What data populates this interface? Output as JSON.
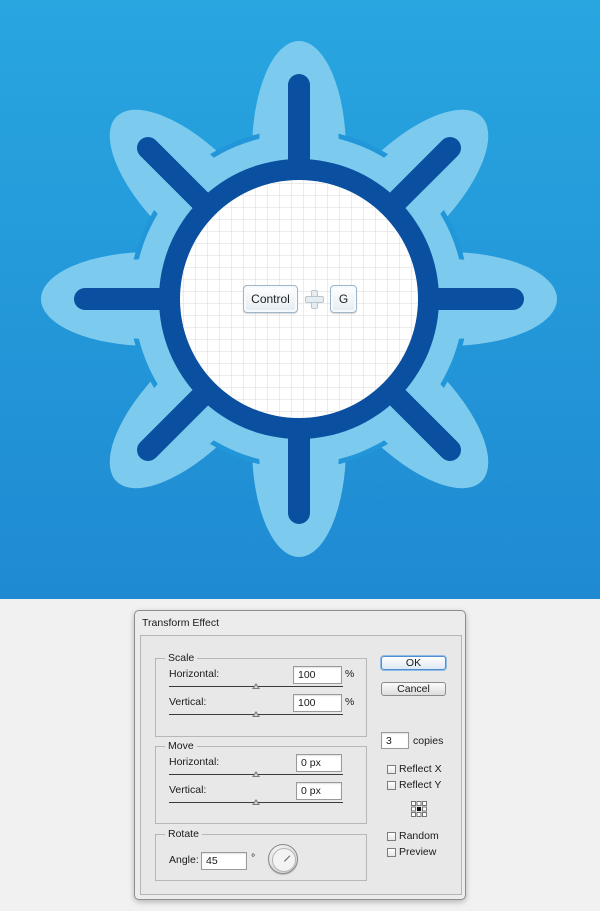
{
  "canvas": {
    "background_top": "#28a6e0",
    "background_bottom": "#1f8ad2",
    "petal_color": "#7ccbee",
    "ring_color": "#0a4fa0",
    "spoke_color": "#0a4fa0",
    "center_color": "#ffffff",
    "grid_color": "#d9d9d9",
    "shortcut": {
      "key1": "Control",
      "key2": "G",
      "plus_icon": "plus-icon"
    }
  },
  "dialog": {
    "title": "Transform Effect",
    "scale": {
      "label": "Scale",
      "horizontal_label": "Horizontal:",
      "horizontal_value": "100",
      "horizontal_unit": "%",
      "vertical_label": "Vertical:",
      "vertical_value": "100",
      "vertical_unit": "%"
    },
    "move": {
      "label": "Move",
      "horizontal_label": "Horizontal:",
      "horizontal_value": "0 px",
      "vertical_label": "Vertical:",
      "vertical_value": "0 px"
    },
    "rotate": {
      "label": "Rotate",
      "angle_label": "Angle:",
      "angle_value": "45",
      "angle_unit": "°",
      "dial_icon": "angle-dial-icon"
    },
    "ok_label": "OK",
    "cancel_label": "Cancel",
    "copies_value": "3",
    "copies_label": "copies",
    "reflect_x_label": "Reflect X",
    "reflect_y_label": "Reflect Y",
    "reference_point_icon": "reference-point-icon",
    "random_label": "Random",
    "preview_label": "Preview",
    "accent_color": "#4f8ed0"
  }
}
